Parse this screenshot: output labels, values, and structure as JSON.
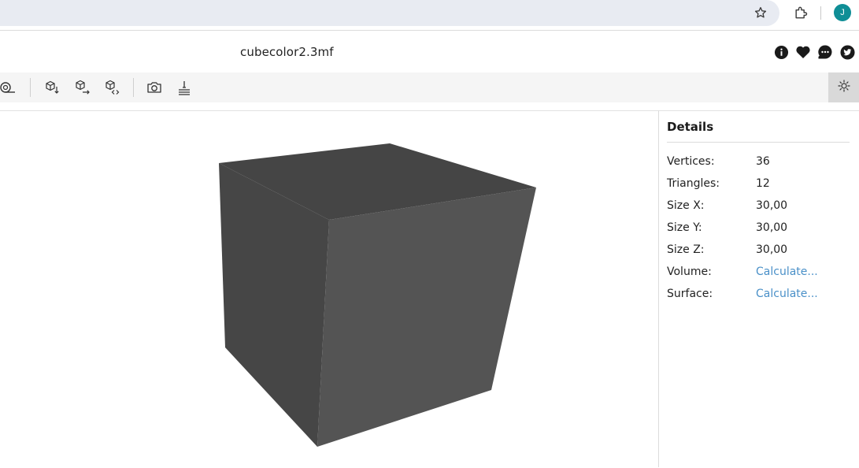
{
  "browser": {
    "avatar_letter": "J",
    "icons": [
      "bookmark-star-icon",
      "extensions-puzzle-icon"
    ],
    "colors": {
      "omnibox": "#e8ebf2",
      "avatar": "#0f8e96"
    }
  },
  "header": {
    "file_name": "cubecolor2.3mf",
    "icons": [
      "info-icon",
      "heart-icon",
      "chat-icon",
      "twitter-icon"
    ]
  },
  "toolbar": {
    "tools": [
      "measure-icon",
      "view-from-top-icon",
      "view-from-side-icon",
      "view-isometric-icon",
      "snapshot-camera-icon",
      "ground-plane-icon"
    ],
    "theme_icon": "sun-icon"
  },
  "details": {
    "title": "Details",
    "rows": [
      {
        "label": "Vertices:",
        "value": "36"
      },
      {
        "label": "Triangles:",
        "value": "12"
      },
      {
        "label": "Size X:",
        "value": "30,00"
      },
      {
        "label": "Size Y:",
        "value": "30,00"
      },
      {
        "label": "Size Z:",
        "value": "30,00"
      },
      {
        "label": "Volume:",
        "value": "Calculate..."
      },
      {
        "label": "Surface:",
        "value": "Calculate..."
      }
    ],
    "colors": {
      "link": "#4a90c8"
    }
  },
  "model": {
    "colors": {
      "left_face": "#464646",
      "top_face": "#454545",
      "right_face": "#545454"
    }
  }
}
